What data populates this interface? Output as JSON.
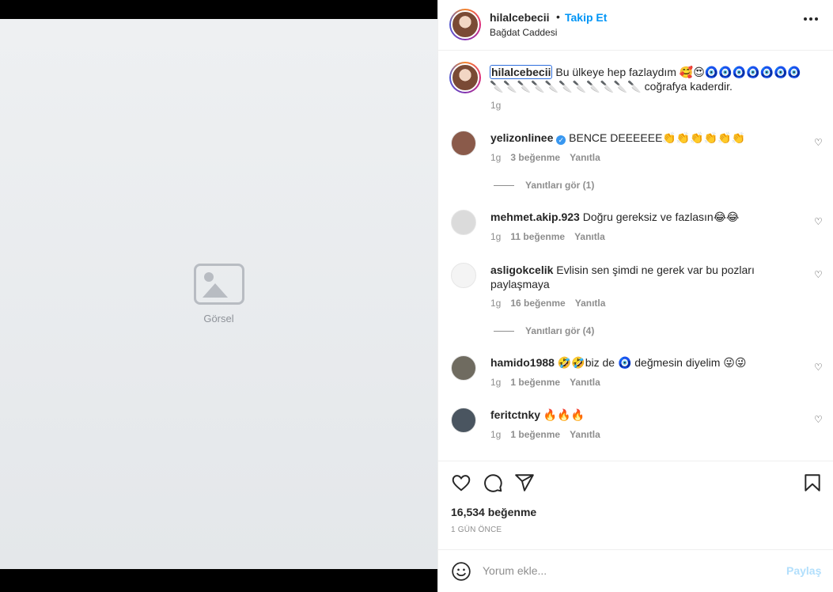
{
  "media": {
    "placeholder_text": "Görsel"
  },
  "header": {
    "username": "hilalcebecii",
    "dot": "•",
    "follow_label": "Takip Et",
    "location": "Bağdat Caddesi"
  },
  "caption": {
    "username": "hilalcebecii",
    "text": "Bu ülkeye hep fazlaydım 🥰😍🧿🧿🧿🧿🧿🧿🧿🔪🔪🔪🔪🔪🔪🔪🔪🔪🔪🔪 coğrafya kaderdir.",
    "time": "1g"
  },
  "comments": [
    {
      "username": "yelizonlinee",
      "verified": true,
      "text": "BENCE DEEEEEE👏👏👏👏👏👏",
      "time": "1g",
      "likes": "3 beğenme",
      "reply": "Yanıtla",
      "replies": "Yanıtları gör (1)",
      "avatar_color": "#8a5a4a"
    },
    {
      "username": "mehmet.akip.923",
      "text": "Doğru gereksiz ve fazlasın😂😂",
      "time": "1g",
      "likes": "11 beğenme",
      "reply": "Yanıtla",
      "avatar_color": "#dbdbdb"
    },
    {
      "username": "asligokcelik",
      "text": "Evlisin sen şimdi ne gerek var bu pozları paylaşmaya",
      "time": "1g",
      "likes": "16 beğenme",
      "reply": "Yanıtla",
      "replies": "Yanıtları gör (4)",
      "avatar_color": "#f4f4f4"
    },
    {
      "username": "hamido1988",
      "text": "🤣🤣biz de 🧿 değmesin diyelim 😜😜",
      "time": "1g",
      "likes": "1 beğenme",
      "reply": "Yanıtla",
      "avatar_color": "#6f6b60"
    },
    {
      "username": "feritctnky",
      "text": "🔥🔥🔥",
      "time": "1g",
      "likes": "1 beğenme",
      "reply": "Yanıtla",
      "avatar_color": "#4a5560"
    }
  ],
  "actions": {
    "like_count": "16,534 beğenme",
    "time_ago": "1 GÜN ÖNCE"
  },
  "comment_box": {
    "placeholder": "Yorum ekle...",
    "share_label": "Paylaş"
  }
}
